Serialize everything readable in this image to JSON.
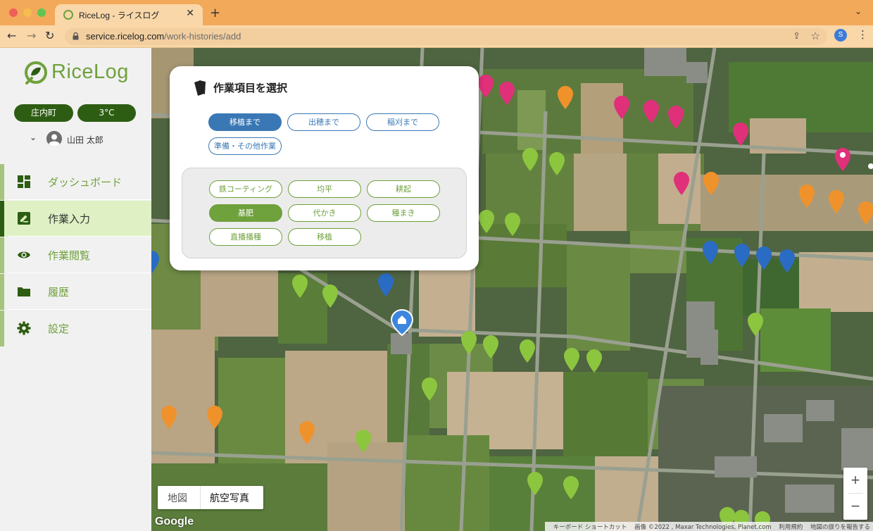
{
  "browser": {
    "tab_title": "RiceLog - ライスログ",
    "url_host": "service.ricelog.com",
    "url_path": "/work-histories/add",
    "profile_initial": "S"
  },
  "sidebar": {
    "logo_text": "RiceLog",
    "location": "庄内町",
    "temperature": "3°C",
    "user_name": "山田 太郎",
    "items": [
      {
        "label": "ダッシュボード",
        "icon": "dashboard-icon",
        "active": false
      },
      {
        "label": "作業入力",
        "icon": "edit-icon",
        "active": true
      },
      {
        "label": "作業閲覧",
        "icon": "eye-icon",
        "active": false
      },
      {
        "label": "履歴",
        "icon": "folder-icon",
        "active": false
      },
      {
        "label": "設定",
        "icon": "gear-icon",
        "active": false
      }
    ]
  },
  "panel": {
    "title": "作業項目を選択",
    "stages": [
      {
        "label": "移植まで",
        "selected": true
      },
      {
        "label": "出穂まで",
        "selected": false
      },
      {
        "label": "稲刈まで",
        "selected": false
      },
      {
        "label": "準備・その他作業",
        "selected": false
      }
    ],
    "tasks": [
      {
        "label": "鉄コーティング",
        "selected": false
      },
      {
        "label": "均平",
        "selected": false
      },
      {
        "label": "耕起",
        "selected": false
      },
      {
        "label": "基肥",
        "selected": true
      },
      {
        "label": "代かき",
        "selected": false
      },
      {
        "label": "種まき",
        "selected": false
      },
      {
        "label": "直播播種",
        "selected": false
      },
      {
        "label": "移植",
        "selected": false
      }
    ]
  },
  "map": {
    "type_options": [
      "地図",
      "航空写真"
    ],
    "selected_type": "航空写真",
    "google_logo": "Google",
    "attribution": [
      "キーボード ショートカット",
      "画像 ©2022 , Maxar Technologies, Planet.com",
      "利用規約",
      "地図の誤りを報告する"
    ],
    "zoom_in": "+",
    "zoom_out": "−",
    "marker_colors": {
      "green": "#8cc63f",
      "pink": "#e0307a",
      "orange": "#f0922b",
      "blue": "#2a6cc4",
      "home": "#3d86e0"
    }
  }
}
